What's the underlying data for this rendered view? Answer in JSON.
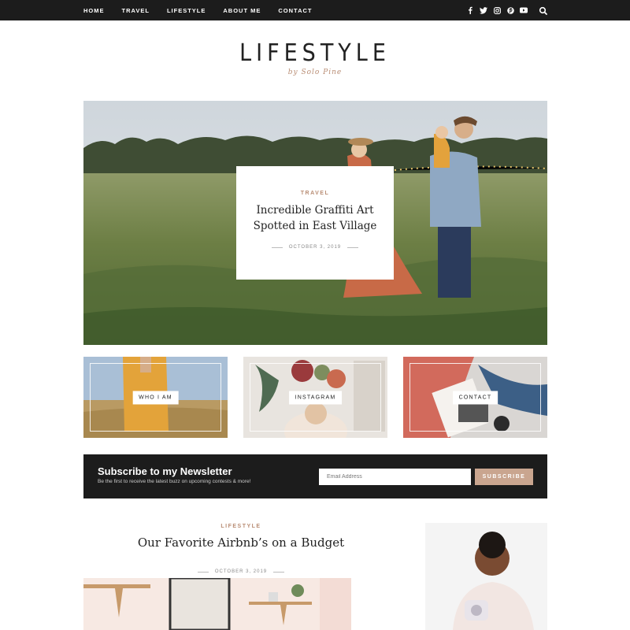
{
  "nav": {
    "items": [
      "HOME",
      "TRAVEL",
      "LIFESTYLE",
      "ABOUT ME",
      "CONTACT"
    ],
    "social_icons": [
      "facebook-icon",
      "twitter-icon",
      "instagram-icon",
      "pinterest-icon",
      "youtube-icon"
    ],
    "search_icon": "search-icon"
  },
  "logo": {
    "title": "LIFESTYLE",
    "subtitle": "by Solo Pine"
  },
  "hero": {
    "category": "TRAVEL",
    "title": "Incredible Graffiti Art Spotted in East Village",
    "date": "OCTOBER 3, 2019"
  },
  "promos": [
    {
      "label": "WHO I AM"
    },
    {
      "label": "INSTAGRAM"
    },
    {
      "label": "CONTACT"
    }
  ],
  "newsletter": {
    "title": "Subscribe to my Newsletter",
    "subtitle": "Be the first to receive the latest buzz on upcoming contests & more!",
    "placeholder": "Email Address",
    "button": "SUBSCRIBE"
  },
  "post": {
    "category": "LIFESTYLE",
    "title": "Our Favorite Airbnb’s on a Budget",
    "date": "OCTOBER 3, 2019"
  },
  "colors": {
    "accent": "#b98d74",
    "dark": "#1c1c1c",
    "button": "#c9a58f"
  }
}
